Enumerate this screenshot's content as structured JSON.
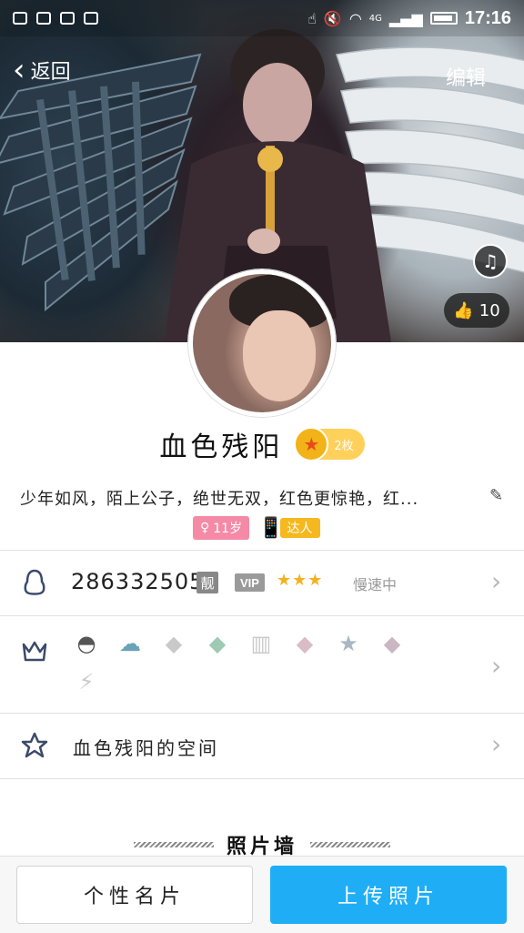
{
  "status_bar": {
    "time": "17:16",
    "network": "4G"
  },
  "nav": {
    "back_label": "返回",
    "edit_label": "编辑"
  },
  "cover": {
    "like_count": "10"
  },
  "profile": {
    "name": "血色残阳",
    "level_badge": "2枚",
    "bio": "少年如风，陌上公子，绝世无双，红色更惊艳，红...",
    "age_tag": "11岁",
    "daren_label": "达人"
  },
  "qq_row": {
    "number": "2863325052",
    "liang": "靓",
    "vip": "VIP",
    "vip_stars": "★★★",
    "speed": "慢速中"
  },
  "space_row": {
    "label": "血色残阳的空间"
  },
  "photo_wall": {
    "title": "照片墙"
  },
  "bottom": {
    "card_label": "个性名片",
    "upload_label": "上传照片"
  }
}
